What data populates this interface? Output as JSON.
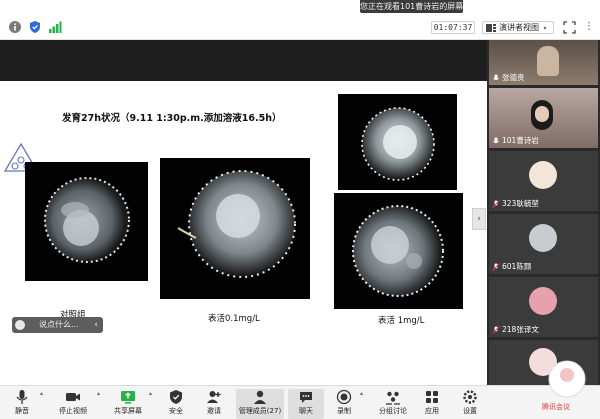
{
  "toast": {
    "text": "您正在观看101曹诗岩的屏幕"
  },
  "topbar": {
    "timer": "01:07:37",
    "view_label": "演讲者视图",
    "icons": [
      "info-icon",
      "shield-icon",
      "signal-icon",
      "grid-icon",
      "fullscreen-icon"
    ]
  },
  "slide": {
    "title": "发育27h状况（9.11 1:30p.m.添加溶液16.5h）",
    "captions": {
      "control": "对照组",
      "dose_01": "表活0.1mg/L",
      "dose_1": "表活 1mg/L"
    }
  },
  "comment_box": {
    "placeholder": "说点什么..."
  },
  "participants": [
    {
      "name": "张德贵"
    },
    {
      "name": "101曹诗岩"
    },
    {
      "name": "323耿毓堃"
    },
    {
      "name": "601陈颢"
    },
    {
      "name": "218张译文"
    },
    {
      "name": ""
    }
  ],
  "toolbar": {
    "mute": "静音",
    "stop_video": "停止视频",
    "share_screen": "共享屏幕",
    "security": "安全",
    "invite": "邀请",
    "manage_members": "管理成员(27)",
    "chat": "聊天",
    "record": "录制",
    "breakout": "分组讨论",
    "apps": "应用",
    "settings": "设置"
  },
  "watermark": {
    "text": "腾讯会议"
  },
  "colors": {
    "accent_green": "#27b14a",
    "tile_bg": "#3b3b3b",
    "panel_bg": "#2a2a2a",
    "record_red": "#e03c3c"
  }
}
